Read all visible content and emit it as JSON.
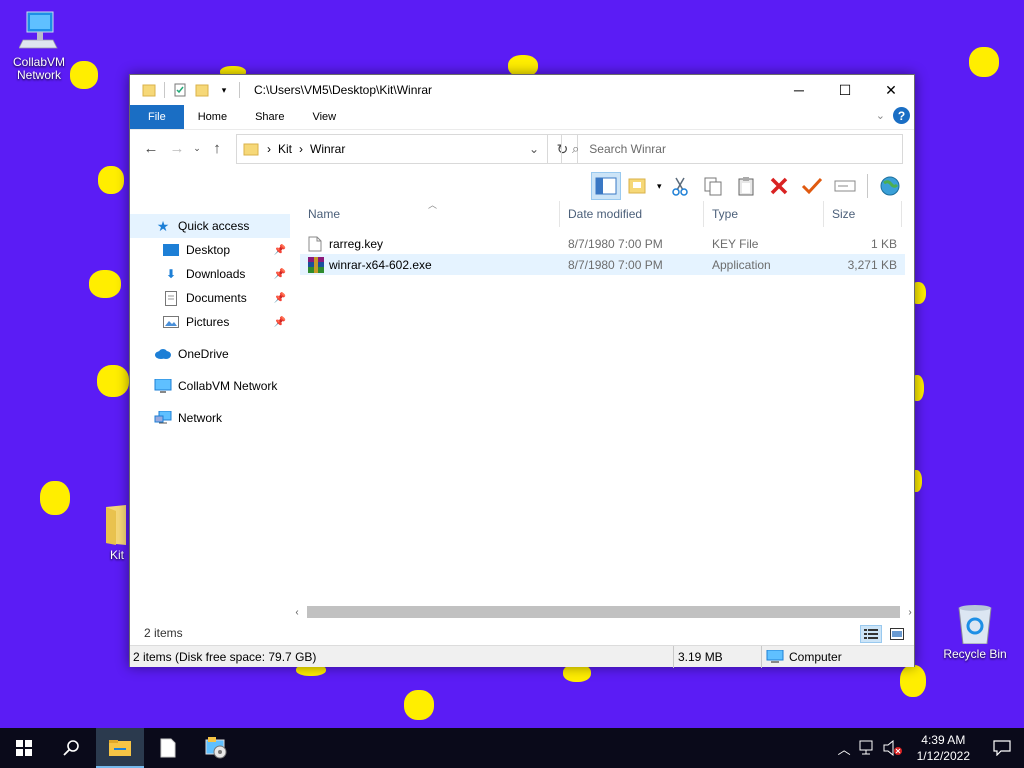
{
  "desktop": {
    "icons": [
      {
        "label_line1": "CollabVM",
        "label_line2": "Network"
      },
      {
        "label": "Kit"
      },
      {
        "label": "Recycle Bin"
      }
    ]
  },
  "window": {
    "title": "C:\\Users\\VM5\\Desktop\\Kit\\Winrar",
    "ribbon_tabs": [
      "File",
      "Home",
      "Share",
      "View"
    ],
    "address": {
      "crumbs": [
        "Kit",
        "Winrar"
      ]
    },
    "search": {
      "placeholder": "Search Winrar"
    },
    "nav": {
      "quick_access": "Quick access",
      "desktop": "Desktop",
      "downloads": "Downloads",
      "documents": "Documents",
      "pictures": "Pictures",
      "onedrive": "OneDrive",
      "collabvm": "CollabVM Network",
      "network": "Network"
    },
    "columns": {
      "name": "Name",
      "date": "Date modified",
      "type": "Type",
      "size": "Size"
    },
    "files": [
      {
        "name": "rarreg.key",
        "date": "8/7/1980 7:00 PM",
        "type": "KEY File",
        "size": "1 KB"
      },
      {
        "name": "winrar-x64-602.exe",
        "date": "8/7/1980 7:00 PM",
        "type": "Application",
        "size": "3,271 KB"
      }
    ],
    "status": {
      "count": "2 items"
    },
    "details": {
      "summary": "2 items (Disk free space: 79.7 GB)",
      "size": "3.19 MB",
      "location": "Computer"
    }
  },
  "taskbar": {
    "time": "4:39 AM",
    "date": "1/12/2022"
  },
  "colors": {
    "desktop_bg": "#5b1cf5",
    "dots": "#ffee00",
    "accent": "#1a6ec4",
    "taskbar": "#0a0a1a"
  }
}
